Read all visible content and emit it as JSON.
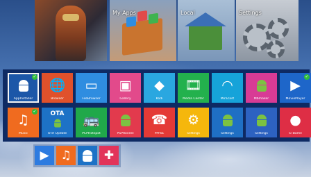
{
  "top_tiles": {
    "my_apps": {
      "label": "My Apps"
    },
    "local": {
      "label": "Local"
    },
    "settings": {
      "label": "Settings"
    }
  },
  "apps_row1": [
    {
      "label": "AppInstaller",
      "color": "#1c57a8",
      "icon": "android-install-icon"
    },
    {
      "label": "Browser",
      "color": "#e0512b",
      "icon": "globe-icon"
    },
    {
      "label": "FileBrowser",
      "color": "#2f8de0",
      "icon": "folder-icon"
    },
    {
      "label": "Gallery",
      "color": "#e24a8b",
      "icon": "image-icon"
    },
    {
      "label": "Kodi",
      "color": "#2aa7e0",
      "icon": "kodi-icon"
    },
    {
      "label": "Media Center",
      "color": "#23b14d",
      "icon": "film-icon"
    },
    {
      "label": "Miracast",
      "color": "#16a3d9",
      "icon": "wifi-icon"
    },
    {
      "label": "Mbmaker",
      "color": "#d83b95",
      "icon": "android-icon"
    },
    {
      "label": "MoviePlayer",
      "color": "#1e66c9",
      "icon": "play-icon"
    }
  ],
  "apps_row2": [
    {
      "label": "Music",
      "color": "#f06b1f",
      "icon": "music-note-icon"
    },
    {
      "label": "OTA Update",
      "color": "#1d72c6",
      "icon": "ota-icon"
    },
    {
      "label": "PCPHotspot",
      "color": "#20a84a",
      "icon": "bus-icon"
    },
    {
      "label": "PSPRovest",
      "color": "#e23a4d",
      "icon": "android-icon"
    },
    {
      "label": "PPPoE",
      "color": "#e43a36",
      "icon": "phone-icon"
    },
    {
      "label": "Settings",
      "color": "#f5b70c",
      "icon": "gear-icon"
    },
    {
      "label": "Settings",
      "color": "#1f6fc4",
      "icon": "android-icon"
    },
    {
      "label": "Settings",
      "color": "#2d62c1",
      "icon": "android-icon"
    },
    {
      "label": "STBame",
      "color": "#de2e45",
      "icon": "sphere-icon"
    }
  ],
  "ota_text": "OTA",
  "dock": [
    {
      "color": "#2d7be0",
      "icon": "play-icon"
    },
    {
      "color": "#f06b1f",
      "icon": "music-note-icon"
    },
    {
      "color": "#1d72c6",
      "icon": "android-install-icon"
    },
    {
      "color": "#e2345a",
      "icon": "plus-icon"
    }
  ]
}
